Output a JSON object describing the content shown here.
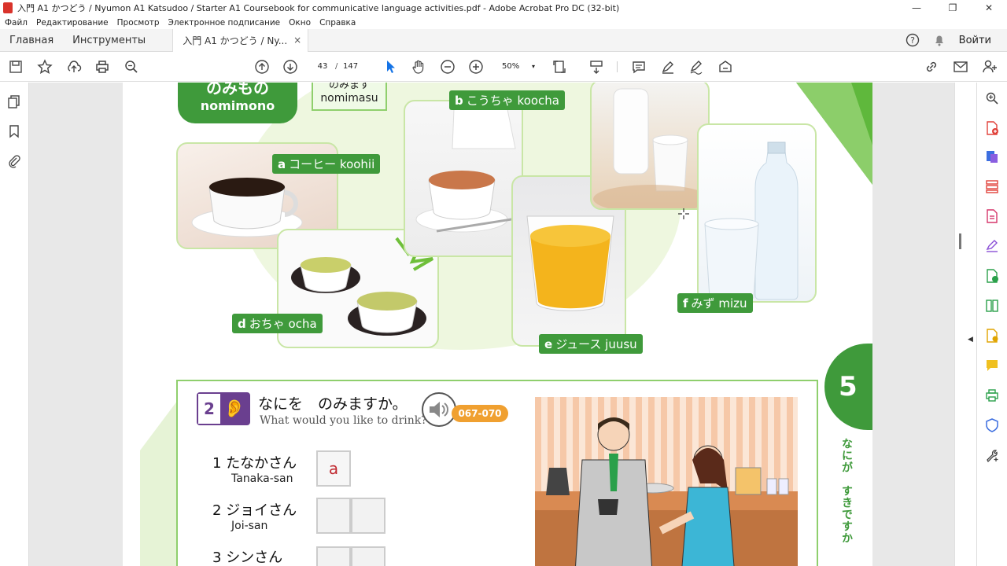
{
  "window": {
    "title": "入門 A1 かつどう / Nyumon A1 Katsudoo / Starter A1 Coursebook for communicative language activities.pdf - Adobe Acrobat Pro DC (32-bit)",
    "minimize": "—",
    "maximize": "❐",
    "close": "✕"
  },
  "menu": [
    "Файл",
    "Редактирование",
    "Просмотр",
    "Электронное подписание",
    "Окно",
    "Справка"
  ],
  "tabs": {
    "home": "Главная",
    "tools": "Инструменты",
    "document": "入門 A1 かつどう / Ny...",
    "close": "×",
    "login": "Войти"
  },
  "toolbar": {
    "page_current": "43",
    "page_sep": "/",
    "page_total": "147",
    "zoom": "50%",
    "zoom_caret": "▾"
  },
  "page": {
    "header_jp": "のみもの",
    "header_ro": "nomimono",
    "verb_jp": "のみます",
    "verb_ro": "nomimasu",
    "items": {
      "a": {
        "letter": "a",
        "jp": "コーヒー",
        "ro": "koohii"
      },
      "b": {
        "letter": "b",
        "jp": "こうちゃ",
        "ro": "koocha"
      },
      "d": {
        "letter": "d",
        "jp": "おちゃ",
        "ro": "ocha"
      },
      "e": {
        "letter": "e",
        "jp": "ジュース",
        "ro": "juusu"
      },
      "f": {
        "letter": "f",
        "jp": "みず",
        "ro": "mizu"
      }
    },
    "exercise": {
      "number": "2",
      "ear": "👂",
      "title": "なにを　のみますか。",
      "subtitle": "What would you like to drink?",
      "track": "067-070",
      "questions": [
        {
          "num": "1",
          "jp": "たなかさん",
          "ro": "Tanaka-san",
          "answer": "a"
        },
        {
          "num": "2",
          "jp": "ジョイさん",
          "ro": "Joi-san",
          "answer": ""
        },
        {
          "num": "3",
          "jp": "シンさん",
          "ro": "",
          "answer": ""
        }
      ]
    },
    "chapter": "5",
    "chapter_vertical": "なにが　すきですか"
  }
}
